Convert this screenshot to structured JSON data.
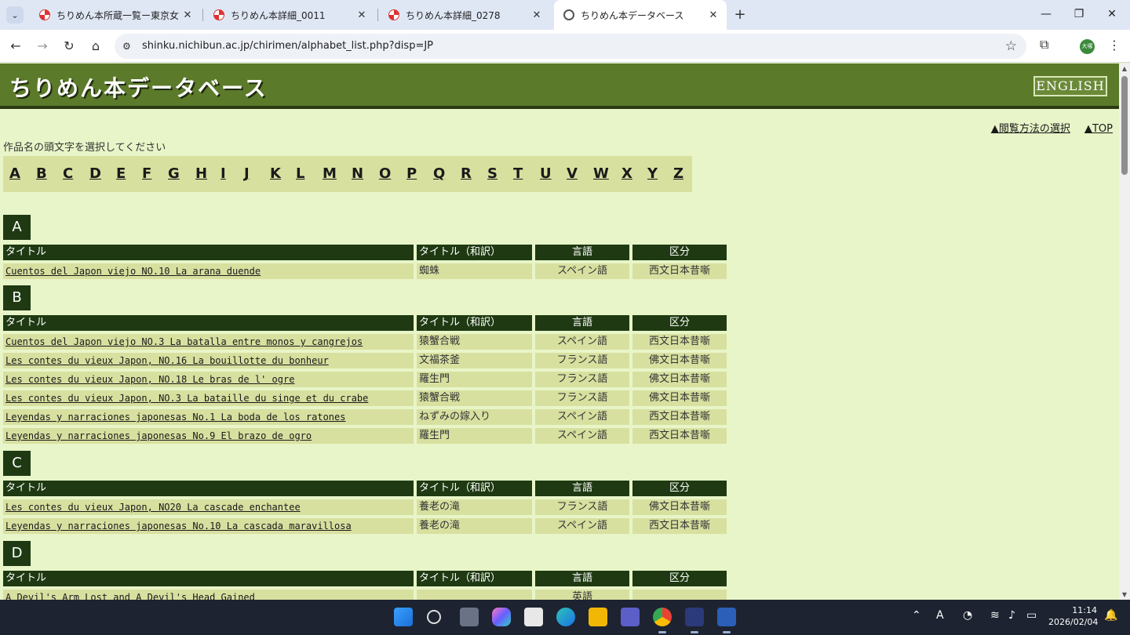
{
  "browser": {
    "tabs": [
      {
        "title": "ちりめん本所蔵一覧ー東京女子大",
        "active": false,
        "icon": "swirl-icon"
      },
      {
        "title": "ちりめん本詳細_0011",
        "active": false,
        "icon": "swirl-icon"
      },
      {
        "title": "ちりめん本詳細_0278",
        "active": false,
        "icon": "swirl-icon"
      },
      {
        "title": "ちりめん本データベース",
        "active": true,
        "icon": "globe-icon"
      }
    ],
    "url": "shinku.nichibun.ac.jp/chirimen/alphabet_list.php?disp=JP",
    "profile_initials": "大塚"
  },
  "page": {
    "logo": "ちりめん本データベース",
    "english_button": "ENGLISH",
    "link_browse": "▲閲覧方法の選択",
    "link_top": "▲TOP",
    "instruction": "作品名の頭文字を選択してください",
    "letters": [
      "A",
      "B",
      "C",
      "D",
      "E",
      "F",
      "G",
      "H",
      "I",
      "J",
      "K",
      "L",
      "M",
      "N",
      "O",
      "P",
      "Q",
      "R",
      "S",
      "T",
      "U",
      "V",
      "W",
      "X",
      "Y",
      "Z"
    ],
    "headers": {
      "title": "タイトル",
      "title_ja": "タイトル（和訳）",
      "language": "言語",
      "category": "区分"
    },
    "sections": [
      {
        "letter": "A",
        "rows": [
          {
            "title": "Cuentos del Japon viejo NO.10 La arana duende",
            "title_ja": "蜘蛛",
            "language": "スペイン語",
            "category": "西文日本昔噺"
          }
        ]
      },
      {
        "letter": "B",
        "rows": [
          {
            "title": "Cuentos del Japon viejo NO.3 La batalla entre monos y cangrejos",
            "title_ja": "猿蟹合戦",
            "language": "スペイン語",
            "category": "西文日本昔噺"
          },
          {
            "title": "Les contes du vieux Japon, NO.16 La bouillotte du bonheur",
            "title_ja": "文福茶釜",
            "language": "フランス語",
            "category": "佛文日本昔噺"
          },
          {
            "title": "Les contes du vieux Japon, NO.18 Le bras de l' ogre",
            "title_ja": "羅生門",
            "language": "フランス語",
            "category": "佛文日本昔噺"
          },
          {
            "title": "Les contes du vieux Japon, NO.3 La bataille du singe et du crabe",
            "title_ja": "猿蟹合戦",
            "language": "フランス語",
            "category": "佛文日本昔噺"
          },
          {
            "title": "Leyendas y narraciones japonesas No.1 La boda de los ratones",
            "title_ja": "ねずみの嫁入り",
            "language": "スペイン語",
            "category": "西文日本昔噺"
          },
          {
            "title": "Leyendas y narraciones japonesas No.9 El brazo de ogro",
            "title_ja": "羅生門",
            "language": "スペイン語",
            "category": "西文日本昔噺"
          }
        ]
      },
      {
        "letter": "C",
        "rows": [
          {
            "title": "Les contes du vieux Japon, NO20 La cascade enchantee",
            "title_ja": "養老の滝",
            "language": "フランス語",
            "category": "佛文日本昔噺"
          },
          {
            "title": "Leyendas y narraciones japonesas No.10 La cascada maravillosa",
            "title_ja": "養老の滝",
            "language": "スペイン語",
            "category": "西文日本昔噺"
          }
        ]
      },
      {
        "letter": "D",
        "rows": [
          {
            "title": "A Devil's Arm Lost and A Devil's Head Gained",
            "title_ja": "",
            "language": "英語",
            "category": ""
          }
        ]
      }
    ]
  },
  "taskbar": {
    "time": "11:14",
    "date": "2026/02/04",
    "ime": "A"
  }
}
